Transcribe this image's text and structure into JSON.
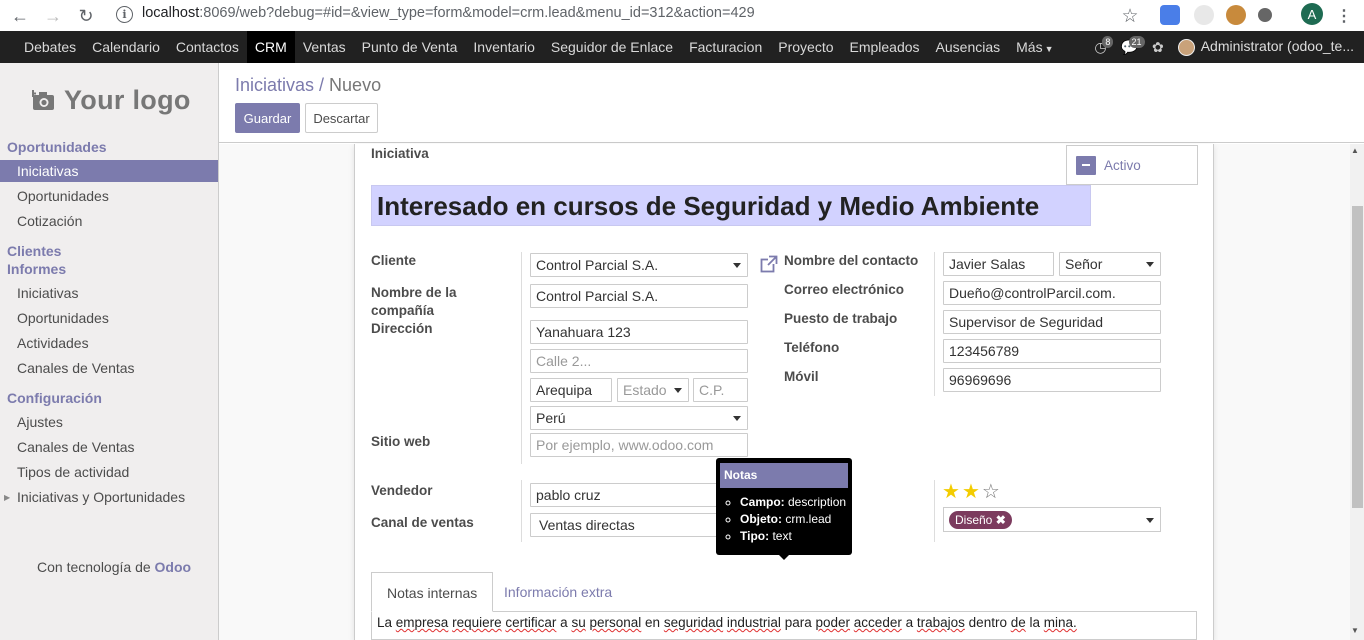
{
  "browser": {
    "url_host": "localhost",
    "url_rest": ":8069/web?debug=#id=&view_type=form&model=crm.lead&menu_id=312&action=429",
    "profile_initial": "A"
  },
  "nav": {
    "items": [
      "Debates",
      "Calendario",
      "Contactos",
      "CRM",
      "Ventas",
      "Punto de Venta",
      "Inventario",
      "Seguidor de Enlace",
      "Facturacion",
      "Proyecto",
      "Empleados",
      "Ausencias",
      "Más"
    ],
    "active": "CRM",
    "discuss_count": "8",
    "messages_count": "21",
    "user": "Administrator (odoo_te..."
  },
  "sidebar": {
    "logo_text": "Your logo",
    "sec_oportunidades": "Oportunidades",
    "iniciativas": "Iniciativas",
    "oportunidades": "Oportunidades",
    "cotizacion": "Cotización",
    "sec_clientes": "Clientes",
    "sec_informes": "Informes",
    "inf_iniciativas": "Iniciativas",
    "inf_oportunidades": "Oportunidades",
    "inf_actividades": "Actividades",
    "inf_canales": "Canales de Ventas",
    "sec_config": "Configuración",
    "cfg_ajustes": "Ajustes",
    "cfg_canales": "Canales de Ventas",
    "cfg_tipos": "Tipos de actividad",
    "cfg_iniciativas_op": "Iniciativas y Oportunidades",
    "powered_prefix": "Con tecnología de ",
    "powered_brand": "Odoo"
  },
  "control_panel": {
    "breadcrumb_parent": "Iniciativas",
    "breadcrumb_sep": " / ",
    "breadcrumb_current": "Nuevo",
    "save": "Guardar",
    "discard": "Descartar"
  },
  "form": {
    "section_label": "Iniciativa",
    "active_button": "Activo",
    "title": "Interesado en cursos de Seguridad y Medio Ambiente",
    "cliente_label": "Cliente",
    "cliente": "Control Parcial S.A.",
    "company_label_1": "Nombre de la",
    "company_label_2": "compañía",
    "company": "Control Parcial S.A.",
    "address_label": "Dirección",
    "street": "Yanahuara 123",
    "street2_placeholder": "Calle 2...",
    "city": "Arequipa",
    "state_placeholder": "Estado",
    "zip_placeholder": "C.P.",
    "country": "Perú",
    "website_label": "Sitio web",
    "website_placeholder": "Por ejemplo, www.odoo.com",
    "contact_label": "Nombre del contacto",
    "contact_name": "Javier Salas",
    "title_select": "Señor",
    "email_label": "Correo electrónico",
    "email": "Dueño@controlParcil.com.",
    "job_label": "Puesto de trabajo",
    "job": "Supervisor de Seguridad",
    "phone_label": "Teléfono",
    "phone": "123456789",
    "mobile_label": "Móvil",
    "mobile": "96969696",
    "salesperson_label": "Vendedor",
    "salesperson": "pablo cruz",
    "channel_label": "Canal de ventas",
    "channel": "Ventas directas",
    "priority_stars": 2,
    "priority_max": 5,
    "tag": "Diseño",
    "tab_notes": "Notas internas",
    "tab_extra": "Información extra",
    "notes_text": "La empresa requiere certificar a su personal en seguridad industrial para poder acceder a trabajos dentro de la mina."
  },
  "tooltip": {
    "title": "Notas",
    "field_key": "Campo:",
    "field_val": " description",
    "object_key": "Objeto:",
    "object_val": " crm.lead",
    "type_key": "Tipo:",
    "type_val": " text"
  }
}
